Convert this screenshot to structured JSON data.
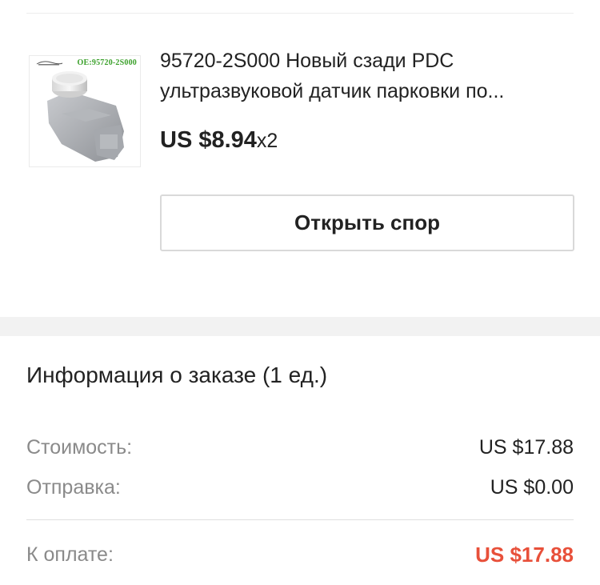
{
  "product": {
    "image_code": "OE:95720-2S000",
    "title": "95720-2S000 Новый сзади PDC ультразвуковой датчик парковки по...",
    "price": "US $8.94",
    "quantity": "x2",
    "dispute_button_label": "Открыть спор"
  },
  "order_info": {
    "heading": "Информация о заказе (1 ед.)",
    "cost_label": "Стоимость:",
    "cost_value": "US $17.88",
    "shipping_label": "Отправка:",
    "shipping_value": "US $0.00",
    "total_label": "К оплате:",
    "total_value": "US $17.88"
  },
  "colors": {
    "accent": "#e8503a",
    "image_code_color": "#3aa02a",
    "label_gray": "#8a8a8a"
  },
  "icons": {
    "product_image": "parking-sensor-photo"
  }
}
